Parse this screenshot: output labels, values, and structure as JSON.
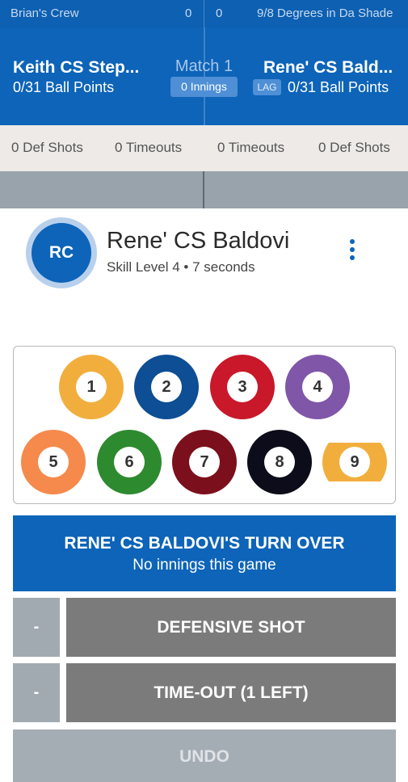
{
  "team_strip": {
    "home_team": "Brian's Crew",
    "home_score": "0",
    "away_score": "0",
    "away_team": "9/8 Degrees in Da Shade"
  },
  "match_header": {
    "left_player": "Keith CS Step...",
    "left_points": "0/31 Ball Points",
    "match_label": "Match 1",
    "innings": "0 Innings",
    "right_player": "Rene' CS Bald...",
    "lag_badge": "LAG",
    "right_points": "0/31 Ball Points"
  },
  "stats": {
    "left_def_shots": "0 Def Shots",
    "left_timeouts": "0 Timeouts",
    "right_timeouts": "0 Timeouts",
    "right_def_shots": "0 Def Shots"
  },
  "player": {
    "initials": "RC",
    "name": "Rene' CS Baldovi",
    "subtitle": "Skill Level 4 • 7 seconds",
    "menu_icon": "more-vertical-icon"
  },
  "balls": [
    {
      "number": "1",
      "color": "#f2ae3c",
      "striped": false
    },
    {
      "number": "2",
      "color": "#0d4e94",
      "striped": false
    },
    {
      "number": "3",
      "color": "#c8182a",
      "striped": false
    },
    {
      "number": "4",
      "color": "#7f56a8",
      "striped": false
    },
    {
      "number": "5",
      "color": "#f58a4c",
      "striped": false
    },
    {
      "number": "6",
      "color": "#2e8a2e",
      "striped": false
    },
    {
      "number": "7",
      "color": "#7c0f1c",
      "striped": false
    },
    {
      "number": "8",
      "color": "#0c0c1a",
      "striped": false
    },
    {
      "number": "9",
      "color": "#f2ae3c",
      "striped": true
    }
  ],
  "turn_over": {
    "title": "RENE' CS BALDOVI'S TURN OVER",
    "subtitle": "No innings this game"
  },
  "defensive": {
    "minus": "-",
    "label": "DEFENSIVE SHOT"
  },
  "timeout": {
    "minus": "-",
    "label": "TIME-OUT (1 LEFT)"
  },
  "undo": {
    "label": "UNDO"
  }
}
